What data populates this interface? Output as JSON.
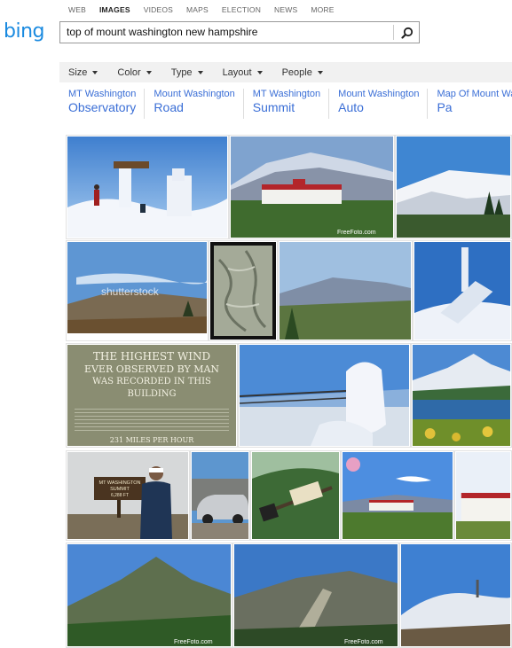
{
  "topnav": [
    "WEB",
    "IMAGES",
    "VIDEOS",
    "MAPS",
    "ELECTION",
    "NEWS",
    "MORE"
  ],
  "logo": "bing",
  "search": {
    "value": "top of mount washington new hampshire"
  },
  "filters": [
    "Size",
    "Color",
    "Type",
    "Layout",
    "People"
  ],
  "related": [
    {
      "l1": "MT Washington",
      "l2": "Observatory"
    },
    {
      "l1": "Mount Washington",
      "l2": "Road"
    },
    {
      "l1": "MT Washington",
      "l2": "Summit"
    },
    {
      "l1": "Mount Washington",
      "l2": "Auto"
    },
    {
      "l1": "Map Of Mount Wash",
      "l2": "Pa"
    }
  ],
  "sign": {
    "title": [
      "THE HIGHEST WIND",
      "EVER OBSERVED BY MAN",
      "WAS RECORDED IN THIS BUILDING"
    ],
    "speed": "231 MILES PER HOUR"
  },
  "watermarks": {
    "freefoto": "FreeFoto.com",
    "shutterstock": "shutterstock"
  },
  "summit_sign": [
    "MT WASHINGTON",
    "SUMMIT",
    "6,288 FT"
  ]
}
